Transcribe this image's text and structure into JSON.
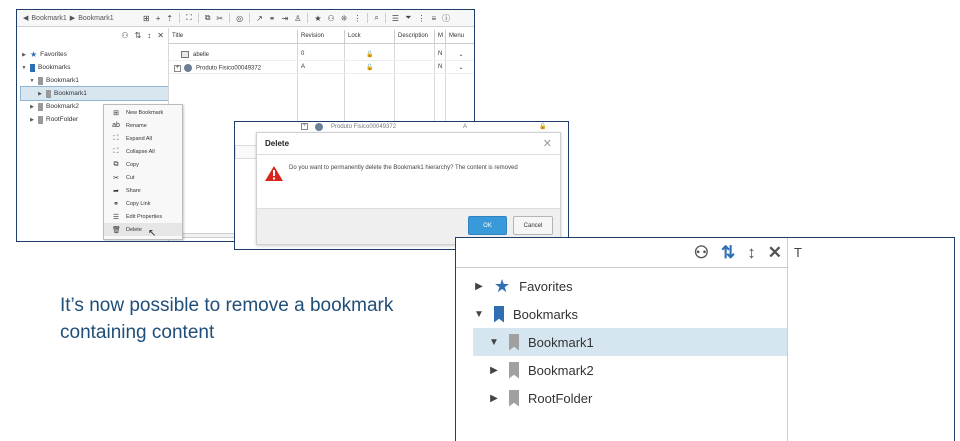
{
  "app": {
    "breadcrumb": [
      "Bookmark1",
      "Bookmark1"
    ],
    "tree": [
      {
        "label": "Favorites",
        "icon": "star-icon",
        "expanded": false,
        "level": 0
      },
      {
        "label": "Bookmarks",
        "icon": "bookmark-icon",
        "expanded": true,
        "level": 0
      },
      {
        "label": "Bookmark1",
        "icon": "bookmark-icon",
        "expanded": true,
        "level": 1
      },
      {
        "label": "Bookmark1",
        "icon": "bookmark-icon",
        "expanded": false,
        "level": 2,
        "selected": true
      },
      {
        "label": "Bookmark2",
        "icon": "bookmark-icon",
        "expanded": false,
        "level": 1
      },
      {
        "label": "RootFolder",
        "icon": "bookmark-icon",
        "expanded": false,
        "level": 1
      }
    ],
    "grid": {
      "columns": [
        "Title",
        "Revision",
        "Lock",
        "Description",
        "M",
        "Menu"
      ],
      "rows": [
        {
          "title": "abelle",
          "revision": "0",
          "m": "N"
        },
        {
          "title": "Produto Fisico00049372",
          "revision": "A",
          "m": "N"
        }
      ]
    },
    "context_menu": [
      {
        "label": "New Bookmark",
        "icon": "new-bookmark-icon"
      },
      {
        "label": "Rename",
        "icon": "rename-icon"
      },
      {
        "label": "Expand All",
        "icon": "expand-all-icon"
      },
      {
        "label": "Collapse All",
        "icon": "collapse-all-icon"
      },
      {
        "label": "Copy",
        "icon": "copy-icon"
      },
      {
        "label": "Cut",
        "icon": "cut-icon"
      },
      {
        "label": "Share",
        "icon": "share-icon"
      },
      {
        "label": "Copy Link",
        "icon": "link-icon"
      },
      {
        "label": "Edit Properties",
        "icon": "properties-icon"
      },
      {
        "label": "Delete",
        "icon": "trash-icon",
        "highlighted": true
      }
    ]
  },
  "dialog": {
    "behind_row": {
      "title": "Produto Fisico00049372",
      "revision": "A"
    },
    "title": "Delete",
    "message": "Do you want to permanently delete the Bookmark1 hierarchy? The content is removed",
    "ok_label": "OK",
    "cancel_label": "Cancel",
    "accent": "#3a9ad9",
    "warning_color": "#d9261c"
  },
  "caption": "It’s now possible to remove a bookmark containing content",
  "zoom": {
    "column_initial": "T",
    "tree": [
      {
        "label": "Favorites",
        "icon": "star-icon",
        "expanded": false,
        "level": 0
      },
      {
        "label": "Bookmarks",
        "icon": "bookmark-icon",
        "expanded": true,
        "level": 0
      },
      {
        "label": "Bookmark1",
        "icon": "bookmark-icon",
        "expanded": true,
        "level": 1,
        "selected": true
      },
      {
        "label": "Bookmark2",
        "icon": "bookmark-icon",
        "expanded": false,
        "level": 1
      },
      {
        "label": "RootFolder",
        "icon": "bookmark-icon",
        "expanded": false,
        "level": 1
      }
    ]
  },
  "colors": {
    "brand_blue": "#2e6fb3",
    "frame": "#1f3d6b",
    "caption": "#1f4e79",
    "selection": "#d6e6f1"
  }
}
